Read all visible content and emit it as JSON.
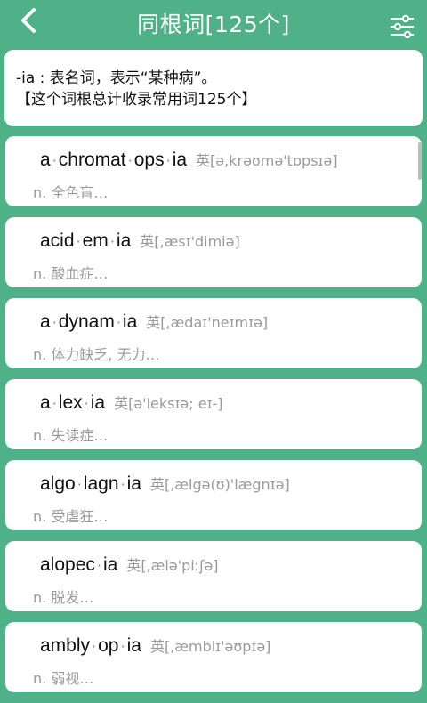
{
  "header": {
    "title": "同根词[125个]",
    "back_icon": "chevron-left-icon",
    "filter_icon": "sliders-icon"
  },
  "description": {
    "line1": "-ia : 表名词，表示“某种病”。",
    "line2": "【这个词根总计收录常用词125个】"
  },
  "words": [
    {
      "parts": [
        "a",
        "chromat",
        "ops",
        "ia"
      ],
      "phonetic": "英[ə,krəʊmə'tɒpsɪə]",
      "meaning": "n. 全色盲…"
    },
    {
      "parts": [
        "acid",
        "em",
        "ia"
      ],
      "phonetic": "英[,æsɪ'dimiə]",
      "meaning": "n. 酸血症…"
    },
    {
      "parts": [
        "a",
        "dynam",
        "ia"
      ],
      "phonetic": "英[,ædaɪ'neɪmɪə]",
      "meaning": "n. 体力缺乏, 无力…"
    },
    {
      "parts": [
        "a",
        "lex",
        "ia"
      ],
      "phonetic": "英[ə'leksɪə; eɪ-]",
      "meaning": "n. 失读症…"
    },
    {
      "parts": [
        "algo",
        "lagn",
        "ia"
      ],
      "phonetic": "英[,ælgə(ʊ)'lægnɪə]",
      "meaning": "n. 受虐狂…"
    },
    {
      "parts": [
        "alopec",
        "ia"
      ],
      "phonetic": "英[,ælə'piːʃə]",
      "meaning": "n. 脱发…"
    },
    {
      "parts": [
        "ambly",
        "op",
        "ia"
      ],
      "phonetic": "英[,æmblɪ'əʊpɪə]",
      "meaning": "n. 弱视…"
    }
  ],
  "colors": {
    "background": "#4fb188",
    "card": "#ffffff",
    "text": "#111111",
    "muted": "#9a9a9a"
  }
}
